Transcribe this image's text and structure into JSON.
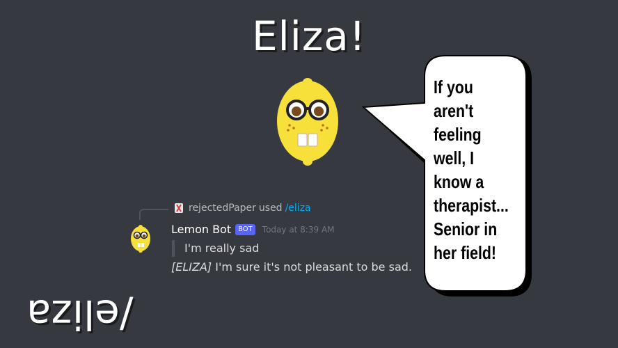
{
  "title": "Eliza!",
  "speech_bubble": {
    "lines": [
      "If you",
      "aren't",
      "feeling",
      "well, I",
      "know a",
      "therapist...",
      "Senior in",
      "her field!"
    ]
  },
  "message": {
    "reply": {
      "user": "rejectedPaper",
      "used_text": "used",
      "command": "/eliza"
    },
    "author": "Lemon Bot",
    "bot_badge": "BOT",
    "timestamp": "Today at 8:39 AM",
    "quote": "I'm really sad",
    "response_tag": "[ELIZA]",
    "response_text": " I'm sure it's not pleasant to be sad."
  },
  "mirrored_command": "/eliza",
  "colors": {
    "background": "#36393f",
    "lemon": "#f7e03a",
    "bot_badge": "#5865f2",
    "command_link": "#00aff4"
  },
  "icons": {
    "mascot": "lemon-face-icon",
    "command": "slash-command-icon"
  }
}
